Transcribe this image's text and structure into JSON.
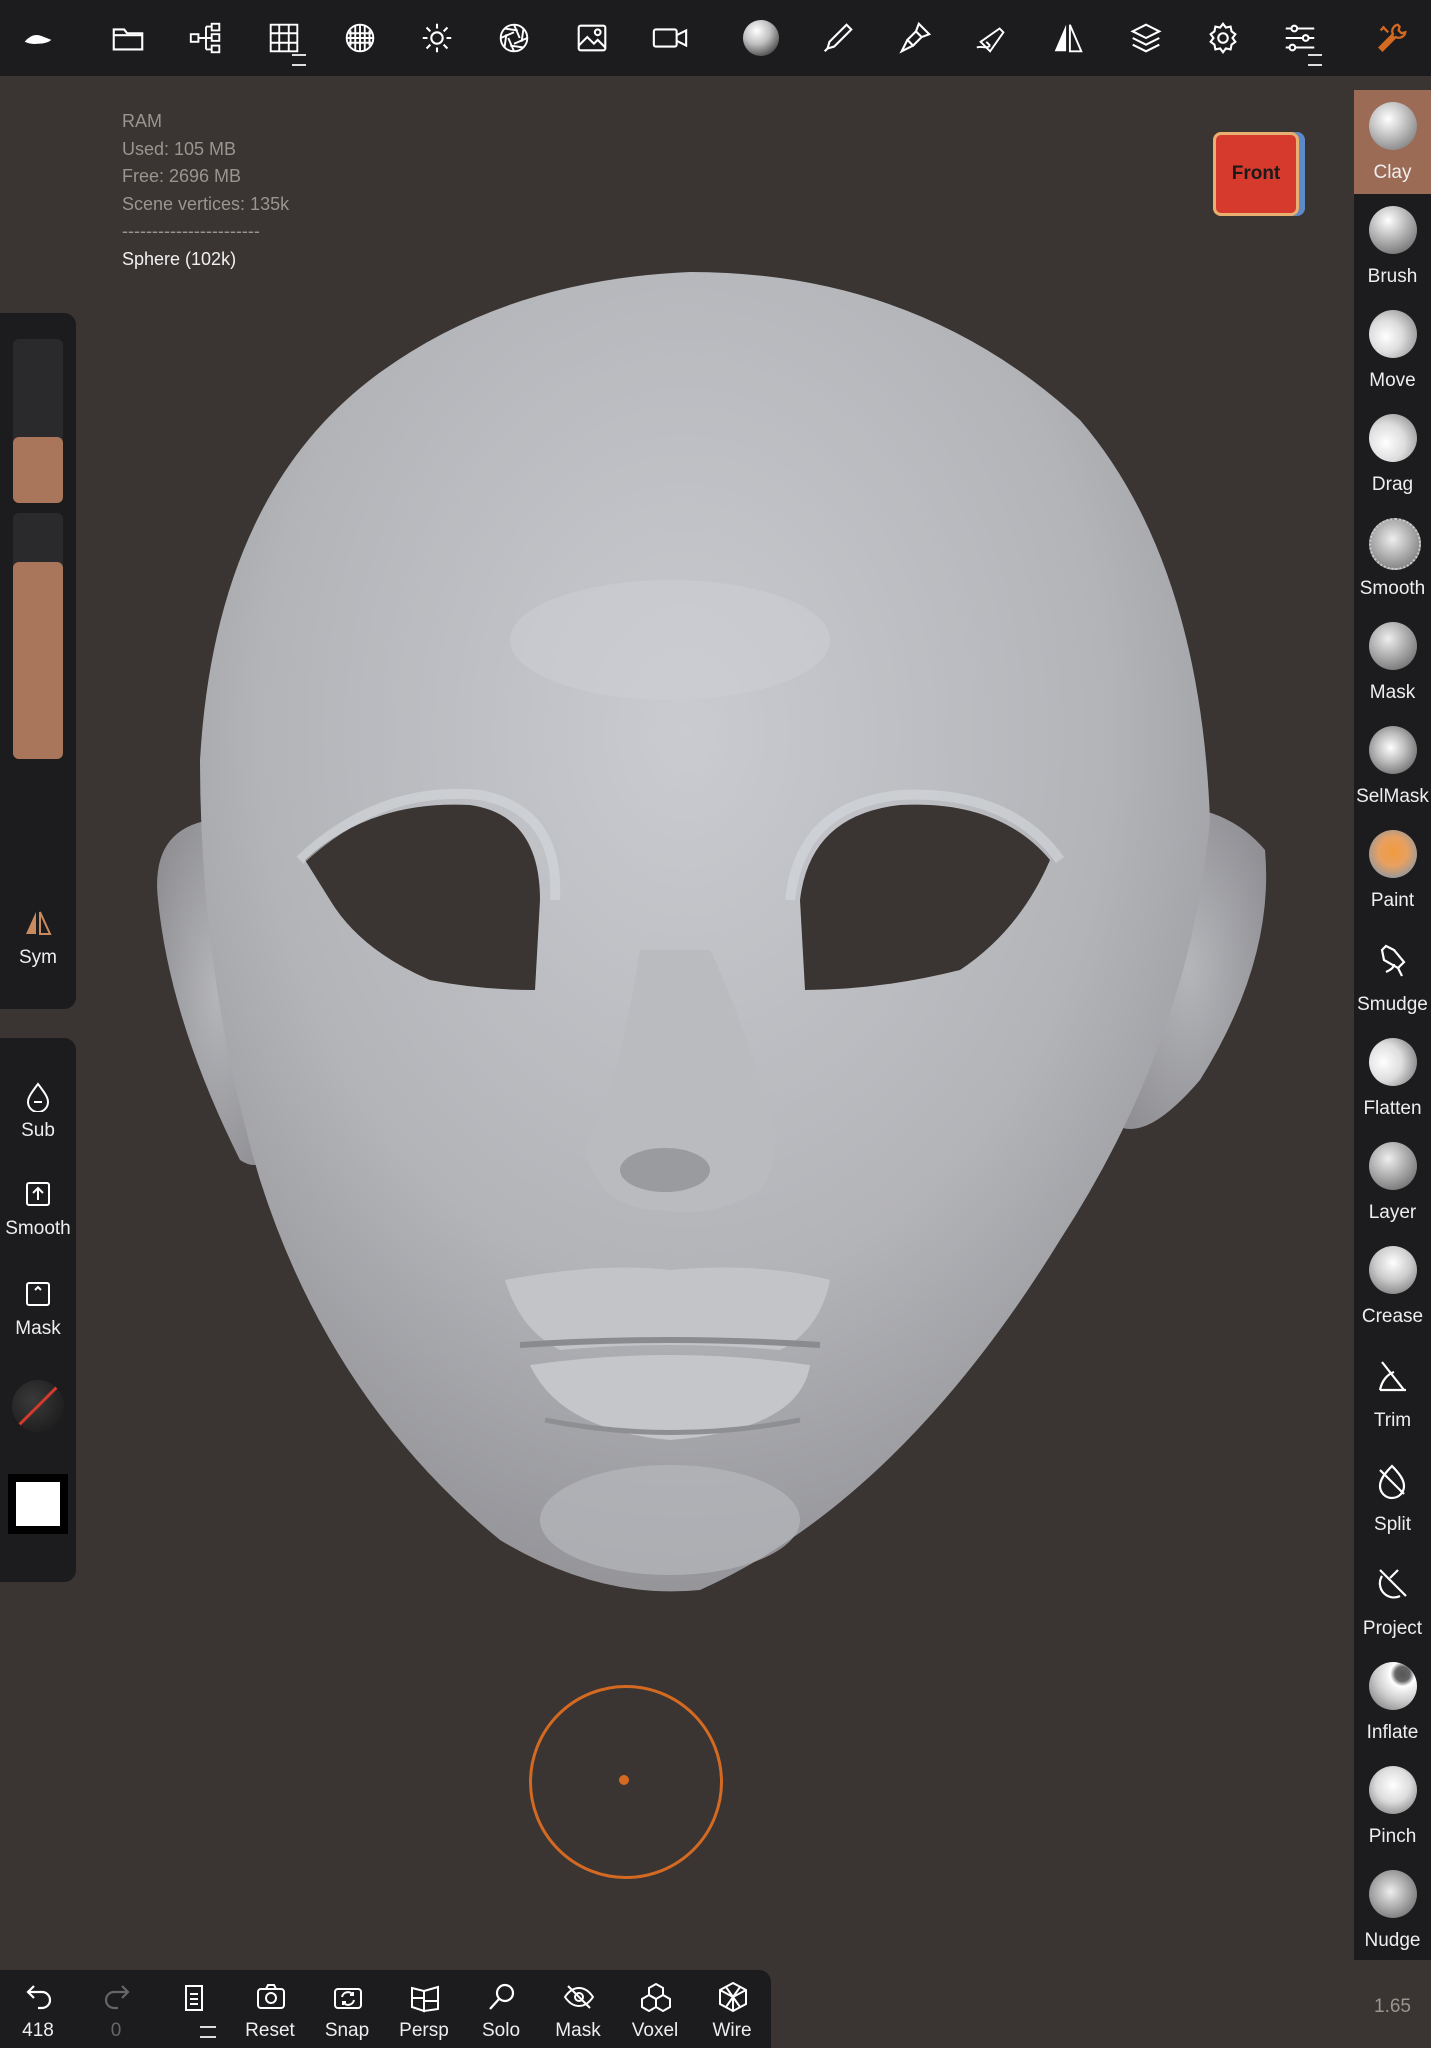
{
  "topbar": {
    "icons": [
      "app-logo-icon",
      "folder-icon",
      "scene-tree-icon",
      "grid-icon",
      "texture-icon",
      "sun-icon",
      "aperture-icon",
      "image-icon",
      "camera-icon",
      "material-sphere-icon",
      "pen-icon",
      "paintbrush-icon",
      "fountain-pen-icon",
      "symmetry-icon",
      "layers-icon",
      "gear-icon",
      "sliders-icon",
      "wrench-icon"
    ]
  },
  "stats": {
    "ram_label": "RAM",
    "used": "Used: 105 MB",
    "free": "Free: 2696 MB",
    "vertices": "Scene vertices: 135k",
    "separator": "-----------------------",
    "object": "Sphere (102k)"
  },
  "view_cube": {
    "label": "Front",
    "color": "#d63a2c"
  },
  "tools": [
    {
      "label": "Clay",
      "active": true
    },
    {
      "label": "Brush"
    },
    {
      "label": "Move"
    },
    {
      "label": "Drag"
    },
    {
      "label": "Smooth"
    },
    {
      "label": "Mask"
    },
    {
      "label": "SelMask"
    },
    {
      "label": "Paint"
    },
    {
      "label": "Smudge"
    },
    {
      "label": "Flatten"
    },
    {
      "label": "Layer"
    },
    {
      "label": "Crease"
    },
    {
      "label": "Trim"
    },
    {
      "label": "Split"
    },
    {
      "label": "Project"
    },
    {
      "label": "Inflate"
    },
    {
      "label": "Pinch"
    },
    {
      "label": "Nudge"
    }
  ],
  "left_panel": {
    "radius_level": 0.4,
    "intensity_level": 0.8,
    "slider_color": "#a9765c",
    "sym_label": "Sym",
    "sub_label": "Sub",
    "smooth_label": "Smooth",
    "mask_label": "Mask",
    "swatch_color": "#ffffff"
  },
  "bottombar": {
    "undo_count": "418",
    "redo_count": "0",
    "buttons": [
      "Reset",
      "Snap",
      "Persp",
      "Solo",
      "Mask",
      "Voxel",
      "Wire"
    ]
  },
  "zoom_level": "1.65",
  "accent_color": "#d46a22"
}
